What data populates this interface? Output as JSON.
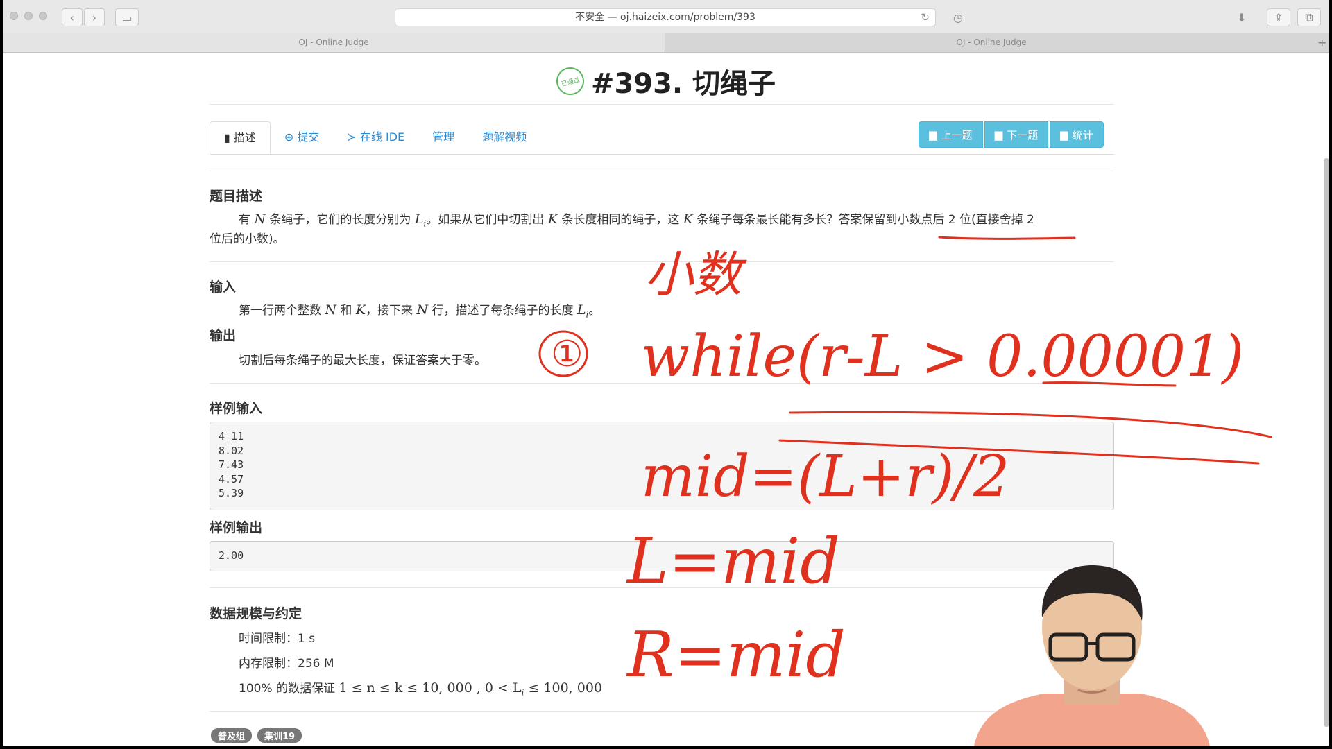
{
  "browser": {
    "address": "不安全 — oj.haizeix.com/problem/393",
    "tabs": [
      "OJ - Online Judge",
      "OJ - Online Judge"
    ]
  },
  "problem": {
    "seal_text": "已通过",
    "title": "#393. 切绳子",
    "tabs": [
      "描述",
      "提交",
      "在线 IDE",
      "管理",
      "题解视频"
    ],
    "nav_buttons": [
      "上一题",
      "下一题",
      "统计"
    ],
    "desc_heading": "题目描述",
    "desc_line1_parts": [
      "有 ",
      "N",
      " 条绳子，它们的长度分别为 ",
      "L",
      "i",
      "。如果从它们中切割出 ",
      "K",
      " 条长度相同的绳子，这 ",
      "K",
      " 条绳子每条最长能有多长？答案保留到小数点后 2 位(直接舍掉 2"
    ],
    "desc_line2": "位后的小数)。",
    "input_heading": "输入",
    "input_parts": [
      "第一行两个整数 ",
      "N",
      " 和 ",
      "K",
      "，接下来 ",
      "N",
      " 行，描述了每条绳子的长度 ",
      "L",
      "i",
      "。"
    ],
    "output_heading": "输出",
    "output_text": "切割后每条绳子的最大长度，保证答案大于零。",
    "sample_input_heading": "样例输入",
    "sample_input": "4 11\n8.02\n7.43\n4.57\n5.39",
    "sample_output_heading": "样例输出",
    "sample_output": "2.00",
    "limits_heading": "数据规模与约定",
    "time_limit": "时间限制：1 s",
    "memory_limit": "内存限制：256 M",
    "constraint_prefix": "100% 的数据保证 ",
    "constraint_math": "1 ≤ n ≤ k ≤ 10, 000 , 0 < L",
    "constraint_sub": "i",
    "constraint_end": " ≤ 100, 000",
    "tags": [
      "普及组",
      "集训19"
    ]
  },
  "annotations": {
    "note_decimal": "小数",
    "step": "①",
    "loop": "while(r-L > 0.00001)",
    "mid": "mid=(L+r)/2",
    "l_assign": "L=mid",
    "r_assign": "R=mid"
  },
  "colors": {
    "ink": "#e0301e",
    "accent": "#5bc0de",
    "link": "#2a8ad2"
  }
}
